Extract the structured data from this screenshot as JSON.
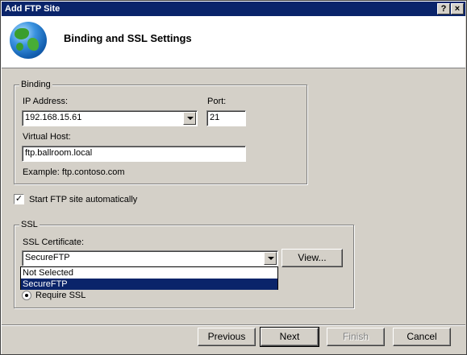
{
  "window": {
    "title": "Add FTP Site",
    "help_button": "?",
    "close_button": "×"
  },
  "header": {
    "title": "Binding and SSL Settings",
    "icon": "globe-icon"
  },
  "binding": {
    "legend": "Binding",
    "ip_label": "IP Address:",
    "ip_value": "192.168.15.61",
    "port_label": "Port:",
    "port_value": "21",
    "vhost_label": "Virtual Host:",
    "vhost_value": "ftp.ballroom.local",
    "example": "Example: ftp.contoso.com"
  },
  "auto_start": {
    "label": "Start FTP site automatically",
    "checked": true,
    "check_mark": "✓"
  },
  "ssl": {
    "legend": "SSL",
    "cert_label": "SSL Certificate:",
    "cert_value": "SecureFTP",
    "view_button": "View...",
    "options": [
      "Not Selected",
      "SecureFTP"
    ],
    "selected_option": "SecureFTP",
    "require_label": "Require SSL"
  },
  "footer": {
    "previous": "Previous",
    "next": "Next",
    "finish": "Finish",
    "cancel": "Cancel"
  }
}
